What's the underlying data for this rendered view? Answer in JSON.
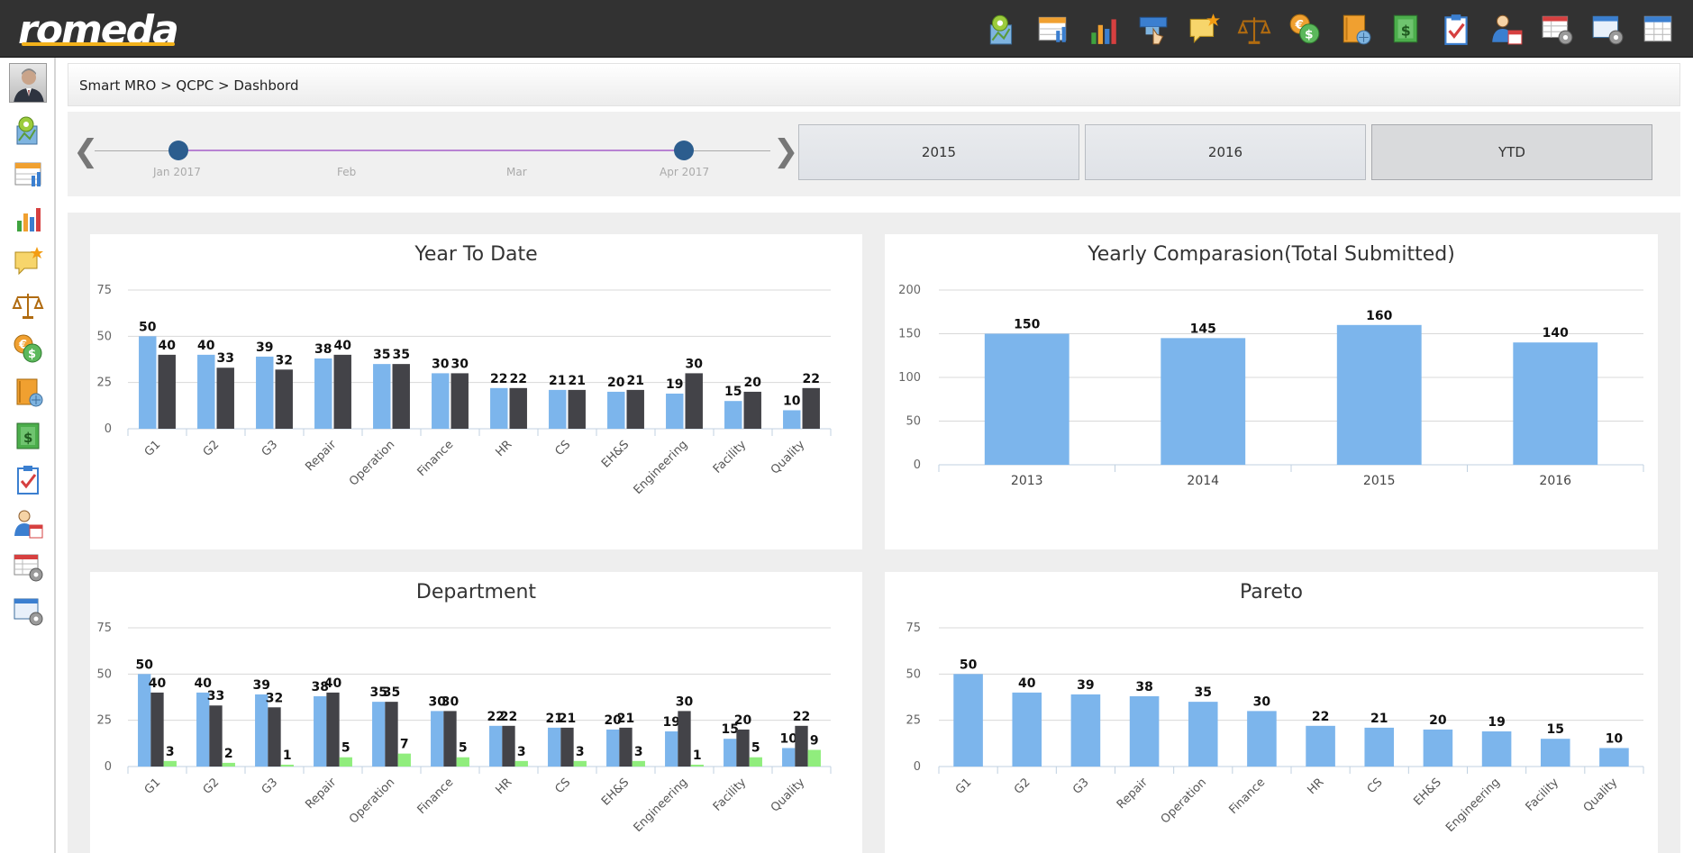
{
  "app": {
    "logo": "romeda"
  },
  "breadcrumb": "Smart MRO > QCPC > Dashbord",
  "top_icons": [
    "map-marker-icon",
    "table-chart-icon",
    "bar-chart-icon",
    "hand-pointer-icon",
    "comment-star-icon",
    "scales-icon",
    "currency-exchange-icon",
    "book-globe-icon",
    "money-book-icon",
    "clipboard-check-icon",
    "user-calendar-icon",
    "table-settings-icon",
    "window-settings-icon",
    "table-icon"
  ],
  "side_icons": [
    "map-marker-icon",
    "table-chart-icon",
    "bar-chart-icon",
    "comment-star-icon",
    "scales-icon",
    "currency-exchange-icon",
    "book-globe-icon",
    "money-book-icon",
    "clipboard-check-icon",
    "user-calendar-icon",
    "table-settings-icon",
    "window-settings-icon"
  ],
  "timeline": {
    "prev_label": "❮",
    "next_label": "❯",
    "ticks": [
      "Jan 2017",
      "Feb",
      "Mar",
      "Apr 2017"
    ]
  },
  "year_buttons": [
    {
      "label": "2015",
      "active": false
    },
    {
      "label": "2016",
      "active": false
    },
    {
      "label": "YTD",
      "active": true
    }
  ],
  "colors": {
    "series_blue": "#7cb5ec",
    "series_dark": "#434348",
    "series_green": "#90ed7d",
    "topbar": "#323232",
    "logo_accent": "#f3b21b"
  },
  "chart_data": [
    {
      "type": "bar",
      "title": "Year To Date",
      "categories": [
        "G1",
        "G2",
        "G3",
        "Repair",
        "Operation",
        "Finance",
        "HR",
        "CS",
        "EH&S",
        "Engineering",
        "Facility",
        "Quality"
      ],
      "series": [
        {
          "values": [
            50,
            40,
            39,
            38,
            35,
            30,
            22,
            21,
            20,
            19,
            15,
            10
          ]
        },
        {
          "values": [
            40,
            33,
            32,
            40,
            35,
            30,
            22,
            21,
            21,
            30,
            20,
            22
          ]
        }
      ],
      "ylim": [
        0,
        75
      ],
      "yticks": [
        0,
        25,
        50,
        75
      ]
    },
    {
      "type": "bar",
      "title": "Yearly Comparasion(Total Submitted)",
      "categories": [
        "2013",
        "2014",
        "2015",
        "2016"
      ],
      "series": [
        {
          "values": [
            150,
            145,
            160,
            140
          ]
        }
      ],
      "ylim": [
        0,
        200
      ],
      "yticks": [
        0,
        50,
        100,
        150,
        200
      ]
    },
    {
      "type": "bar",
      "title": "Department",
      "categories": [
        "G1",
        "G2",
        "G3",
        "Repair",
        "Operation",
        "Finance",
        "HR",
        "CS",
        "EH&S",
        "Engineering",
        "Facility",
        "Quality"
      ],
      "series": [
        {
          "values": [
            50,
            40,
            39,
            38,
            35,
            30,
            22,
            21,
            20,
            19,
            15,
            10
          ]
        },
        {
          "values": [
            40,
            33,
            32,
            40,
            35,
            30,
            22,
            21,
            21,
            30,
            20,
            22
          ]
        },
        {
          "values": [
            3,
            2,
            1,
            5,
            7,
            5,
            3,
            3,
            3,
            1,
            5,
            9
          ]
        }
      ],
      "ylim": [
        0,
        75
      ],
      "yticks": [
        0,
        25,
        50,
        75
      ]
    },
    {
      "type": "bar",
      "title": "Pareto",
      "categories": [
        "G1",
        "G2",
        "G3",
        "Repair",
        "Operation",
        "Finance",
        "HR",
        "CS",
        "EH&S",
        "Engineering",
        "Facility",
        "Quality"
      ],
      "series": [
        {
          "values": [
            50,
            40,
            39,
            38,
            35,
            30,
            22,
            21,
            20,
            19,
            15,
            10
          ]
        }
      ],
      "ylim": [
        0,
        75
      ],
      "yticks": [
        0,
        25,
        50,
        75
      ]
    }
  ]
}
